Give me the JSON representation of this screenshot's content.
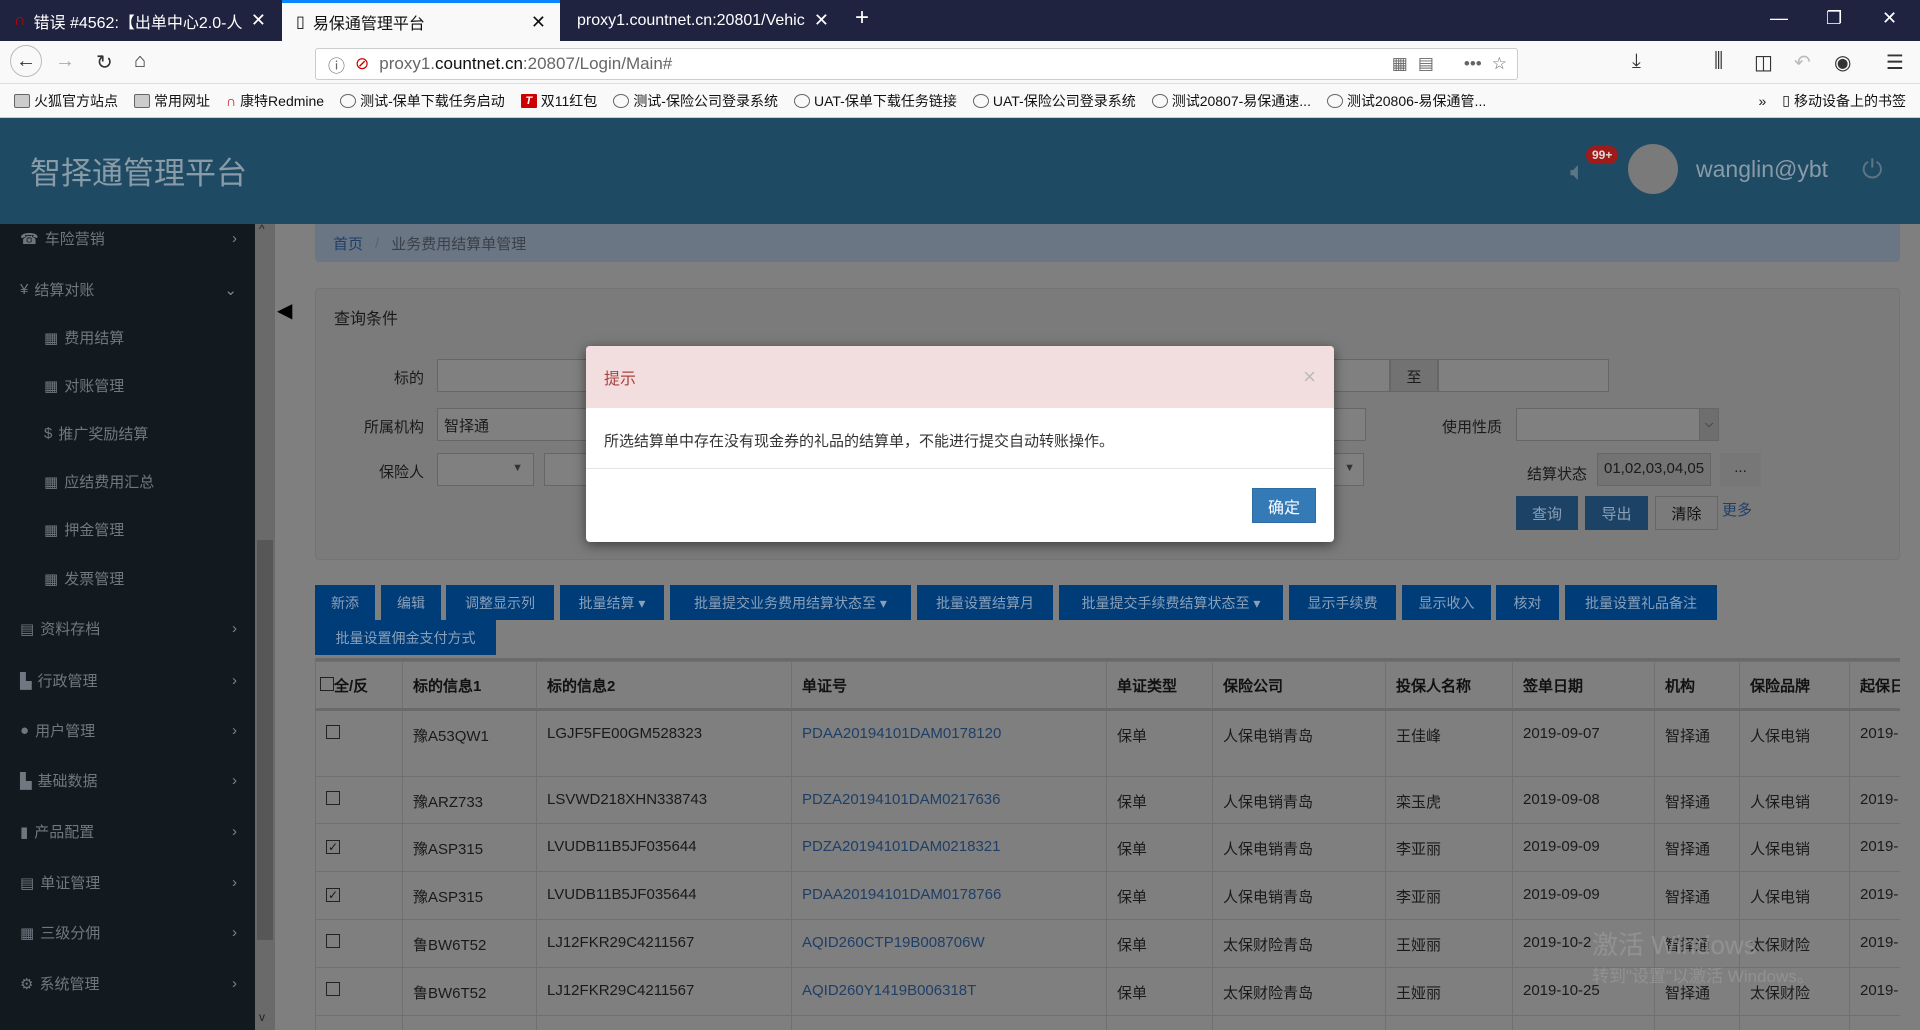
{
  "browser": {
    "tabs": [
      {
        "label": "错误 #4562:【出单中心2.0-人"
      },
      {
        "label": "易保通管理平台"
      },
      {
        "label": "proxy1.countnet.cn:20801/Vehic"
      }
    ],
    "url_prefix": "proxy1.",
    "url_domain": "countnet.cn",
    "url_suffix": ":20807/Login/Main#",
    "bookmarks": [
      {
        "label": "火狐官方站点",
        "icon": "folder"
      },
      {
        "label": "常用网址",
        "icon": "folder"
      },
      {
        "label": "康特Redmine",
        "icon": "redmine"
      },
      {
        "label": "测试-保单下载任务启动",
        "icon": "globe"
      },
      {
        "label": "双11红包",
        "icon": "t"
      },
      {
        "label": "测试-保险公司登录系统",
        "icon": "globe"
      },
      {
        "label": "UAT-保单下载任务链接",
        "icon": "globe"
      },
      {
        "label": "UAT-保险公司登录系统",
        "icon": "globe"
      },
      {
        "label": "测试20807-易保通速...",
        "icon": "globe"
      },
      {
        "label": "测试20806-易保通管...",
        "icon": "globe"
      }
    ],
    "mobile_bookmarks": "移动设备上的书签"
  },
  "header": {
    "title": "智择通管理平台",
    "badge": "99+",
    "username": "wanglin@ybt"
  },
  "sidebar": {
    "items": [
      {
        "label": "车险营销",
        "icon": "☎",
        "sub": false,
        "chev": "›"
      },
      {
        "label": "结算对账",
        "icon": "¥",
        "sub": false,
        "chev": "⌄"
      },
      {
        "label": "费用结算",
        "icon": "▦",
        "sub": true
      },
      {
        "label": "对账管理",
        "icon": "▦",
        "sub": true
      },
      {
        "label": "推广奖励结算",
        "icon": "$",
        "sub": true
      },
      {
        "label": "应结费用汇总",
        "icon": "▦",
        "sub": true
      },
      {
        "label": "押金管理",
        "icon": "▦",
        "sub": true
      },
      {
        "label": "发票管理",
        "icon": "▦",
        "sub": true
      },
      {
        "label": "资料存档",
        "icon": "▤",
        "sub": false,
        "chev": "›"
      },
      {
        "label": "行政管理",
        "icon": "▙",
        "sub": false,
        "chev": "›"
      },
      {
        "label": "用户管理",
        "icon": "●",
        "sub": false,
        "chev": "›"
      },
      {
        "label": "基础数据",
        "icon": "▙",
        "sub": false,
        "chev": "›"
      },
      {
        "label": "产品配置",
        "icon": "▮",
        "sub": false,
        "chev": "›"
      },
      {
        "label": "单证管理",
        "icon": "▤",
        "sub": false,
        "chev": "›"
      },
      {
        "label": "三级分佣",
        "icon": "▦",
        "sub": false,
        "chev": "›"
      },
      {
        "label": "系统管理",
        "icon": "⚙",
        "sub": false,
        "chev": "›"
      }
    ]
  },
  "breadcrumb": {
    "home": "首页",
    "sep": "/",
    "current": "业务费用结算单管理"
  },
  "query": {
    "title": "查询条件",
    "target_label": "标的",
    "org_label": "所属机构",
    "org_value": "智择通",
    "insurer_label": "保险人",
    "to_label": "至",
    "usage_label": "使用性质",
    "status_label": "结算状态",
    "status_value": "01,02,03,04,05",
    "ellipsis": "...",
    "search": "查询",
    "export": "导出",
    "clear": "清除",
    "more": "更多"
  },
  "toolbar": [
    "新添",
    "编辑",
    "调整显示列",
    "批量结算 ▾",
    "批量提交业务费用结算状态至 ▾",
    "批量设置结算月",
    "批量提交手续费结算状态至 ▾",
    "显示手续费",
    "显示收入",
    "核对",
    "批量设置礼品备注",
    "批量设置佣金支付方式"
  ],
  "table": {
    "headers": [
      "全/反",
      "标的信息1",
      "标的信息2",
      "单证号",
      "单证类型",
      "保险公司",
      "投保人名称",
      "签单日期",
      "机构",
      "保险品牌",
      "起保日"
    ],
    "rows": [
      {
        "checked": false,
        "c": [
          "豫A53QW1",
          "LGJF5FE00GM528323",
          "PDAA20194101DAM0178120",
          "保单",
          "人保电销青岛",
          "王佳峰",
          "2019-09-07",
          "智择通",
          "人保电销",
          "2019-"
        ]
      },
      {
        "checked": false,
        "c": [
          "豫ARZ733",
          "LSVWD218XHN338743",
          "PDZA20194101DAM0217636",
          "保单",
          "人保电销青岛",
          "栾玉虎",
          "2019-09-08",
          "智择通",
          "人保电销",
          "2019-"
        ]
      },
      {
        "checked": true,
        "c": [
          "豫ASP315",
          "LVUDB11B5JF035644",
          "PDZA20194101DAM0218321",
          "保单",
          "人保电销青岛",
          "李亚丽",
          "2019-09-09",
          "智择通",
          "人保电销",
          "2019-"
        ]
      },
      {
        "checked": true,
        "c": [
          "豫ASP315",
          "LVUDB11B5JF035644",
          "PDAA20194101DAM0178766",
          "保单",
          "人保电销青岛",
          "李亚丽",
          "2019-09-09",
          "智择通",
          "人保电销",
          "2019-"
        ]
      },
      {
        "checked": false,
        "c": [
          "鲁BW6T52",
          "LJ12FKR29C4211567",
          "AQID260CTP19B008706W",
          "保单",
          "太保财险青岛",
          "王娅丽",
          "2019-10-2",
          "智择通",
          "太保财险",
          "2019-"
        ]
      },
      {
        "checked": false,
        "c": [
          "鲁BW6T52",
          "LJ12FKR29C4211567",
          "AQID260Y1419B006318T",
          "保单",
          "太保财险青岛",
          "王娅丽",
          "2019-10-25",
          "智择通",
          "太保财险",
          "2019-"
        ]
      }
    ]
  },
  "dialog": {
    "title": "提示",
    "message": "所选结算单中存在没有现金券的礼品的结算单，不能进行提交自动转账操作。",
    "ok": "确定"
  },
  "watermark": {
    "line1": "激活 Windows",
    "line2": "转到\"设置\"以激活 Windows。"
  }
}
